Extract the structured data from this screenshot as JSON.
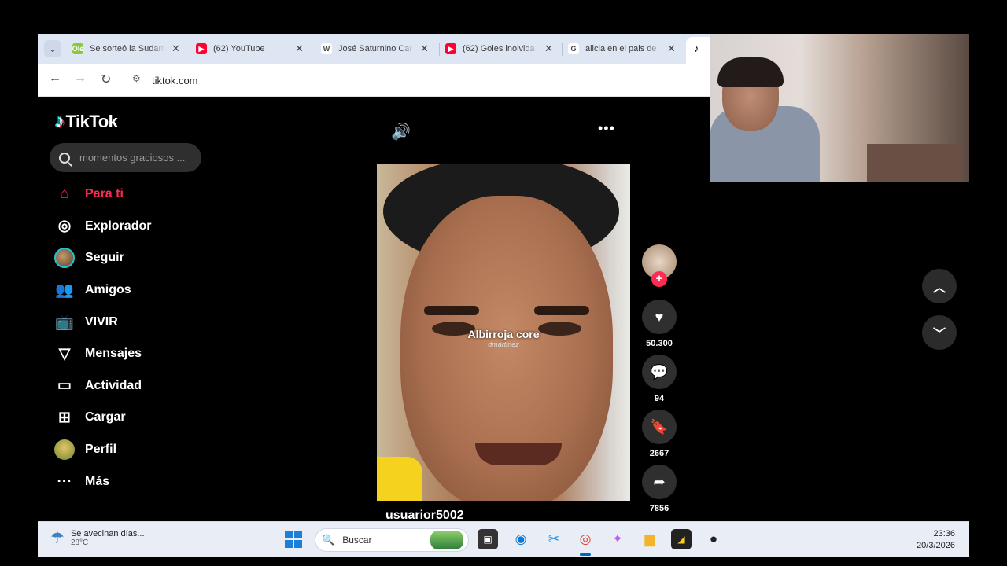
{
  "browser": {
    "tabs": [
      {
        "title": "Se sorteó la Sudam",
        "favicon": "Olé",
        "color": "#8dc63f"
      },
      {
        "title": "(62) YouTube",
        "favicon": "▶",
        "color": "#ff0033"
      },
      {
        "title": "José Saturnino Car",
        "favicon": "W",
        "color": "#ffffff"
      },
      {
        "title": "(62) Goles inolvida",
        "favicon": "▶",
        "color": "#ff0033"
      },
      {
        "title": "alicia en el pais de",
        "favicon": "G",
        "color": "#ffffff"
      }
    ],
    "url": "tiktok.com"
  },
  "tiktok": {
    "logo": "TikTok",
    "search_placeholder": "momentos graciosos ...",
    "menu": [
      {
        "label": "Para ti",
        "icon": "home-icon"
      },
      {
        "label": "Explorador",
        "icon": "compass-icon"
      },
      {
        "label": "Seguir",
        "icon": "following-avatar"
      },
      {
        "label": "Amigos",
        "icon": "friends-icon"
      },
      {
        "label": "VIVIR",
        "icon": "live-icon"
      },
      {
        "label": "Mensajes",
        "icon": "messages-icon"
      },
      {
        "label": "Actividad",
        "icon": "activity-icon"
      },
      {
        "label": "Cargar",
        "icon": "upload-icon"
      },
      {
        "label": "Perfil",
        "icon": "profile-avatar"
      },
      {
        "label": "Más",
        "icon": "more-icon"
      }
    ],
    "video": {
      "caption": "Albirroja core",
      "watermark": "dmartinez",
      "username": "usuarior5002",
      "likes": "50.300",
      "comments": "94",
      "saves": "2667",
      "shares": "7856"
    },
    "accent_color": "#fe2c55"
  },
  "taskbar": {
    "weather_text": "Se avecinan días...",
    "weather_temp": "28°C",
    "search_label": "Buscar",
    "time": "23:36",
    "date": "20/3/2026"
  }
}
